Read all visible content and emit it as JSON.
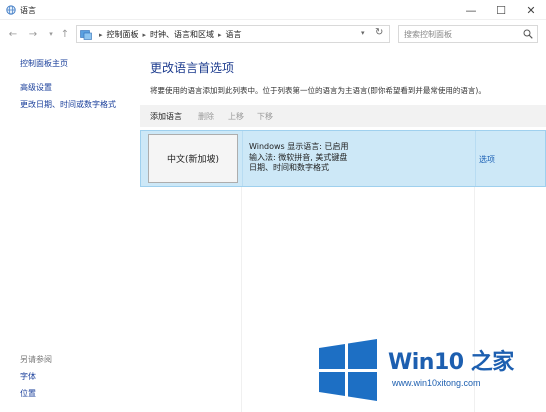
{
  "window": {
    "title": "语言",
    "minimize": "—",
    "maximize": "☐",
    "close": "✕"
  },
  "nav": {
    "back": "←",
    "forward": "→",
    "up": "↑",
    "breadcrumbs": [
      "控制面板",
      "时钟、语言和区域",
      "语言"
    ],
    "search_placeholder": "搜索控制面板"
  },
  "left": {
    "home": "控制面板主页",
    "advanced": "高级设置",
    "date_format": "更改日期、时间或数字格式",
    "see_also": "另请参阅",
    "fonts": "字体",
    "location": "位置"
  },
  "main": {
    "title": "更改语言首选项",
    "description": "将要使用的语言添加到此列表中。位于列表第一位的语言为主语言(即你希望看到并最常使用的语言)。",
    "toolbar": {
      "add": "添加语言",
      "delete": "删除",
      "move_up": "上移",
      "move_down": "下移"
    },
    "language": {
      "name": "中文(新加坡)",
      "line1": "Windows 显示语言: 已启用",
      "line2": "输入法: 微软拼音, 美式键盘",
      "line3": "日期、时间和数字格式",
      "options": "选项"
    }
  },
  "watermark": {
    "title": "Win10 之家",
    "url": "www.win10xitong.com"
  }
}
